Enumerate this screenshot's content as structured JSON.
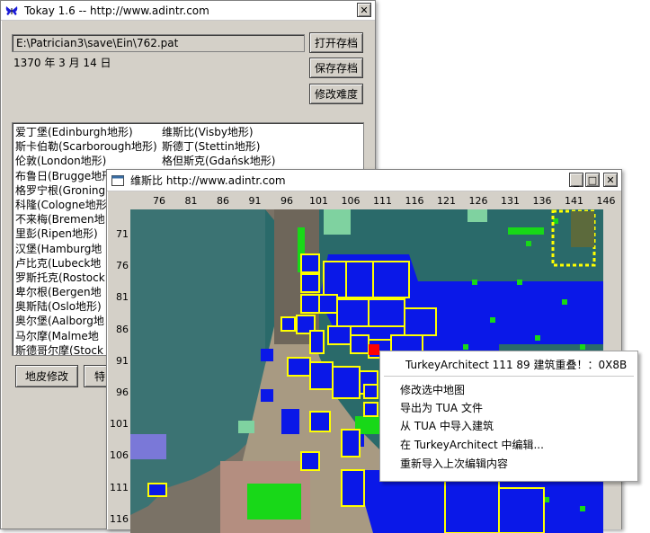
{
  "main_window": {
    "title": "Tokay 1.6 -- http://www.adintr.com",
    "close_glyph": "✕",
    "save_path": "E:\\Patrician3\\save\\Ein\\762.pat",
    "game_date": "1370 年 3 月 14 日",
    "buttons": {
      "open_save": "打开存档",
      "save_save": "保存存档",
      "change_difficulty": "修改难度",
      "terrain_edit": "地皮修改",
      "special_partial": "特"
    },
    "towns_left": [
      "爱丁堡(Edinburgh地形)",
      "斯卡伯勒(Scarborough地形)",
      "伦敦(London地形)",
      "布鲁日(Brugge地形",
      "格罗宁根(Groning",
      "科隆(Cologne地形",
      "不来梅(Bremen地",
      "里彭(Ripen地形)",
      "汉堡(Hamburg地",
      "卢比克(Lubeck地",
      "罗斯托克(Rostock",
      "卑尔根(Bergen地",
      "奥斯陆(Oslo地形)",
      "奥尔堡(Aalborg地",
      "马尔摩(Malme地",
      "斯德哥尔摩(Stock"
    ],
    "towns_right": [
      "维斯比(Visby地形)",
      "斯德丁(Stettin地形)",
      "格但斯克(Gdańsk地形)"
    ]
  },
  "map_window": {
    "title": "维斯比   http://www.adintr.com",
    "buttons": {
      "minimize": "_",
      "maximize": "□",
      "close": "✕"
    },
    "x_ticks": [
      "76",
      "81",
      "86",
      "91",
      "96",
      "101",
      "106",
      "111",
      "116",
      "121",
      "126",
      "131",
      "136",
      "141",
      "146"
    ],
    "y_ticks": [
      "71",
      "76",
      "81",
      "86",
      "91",
      "96",
      "101",
      "106",
      "111",
      "116"
    ]
  },
  "context_menu": {
    "header": "TurkeyArchitect 111 89 建筑重叠！：0X8B",
    "items": [
      "修改选中地图",
      "导出为 TUA 文件",
      "从 TUA 中导入建筑",
      "在 TurkeyArchitect 中编辑...",
      "重新导入上次编辑内容"
    ]
  },
  "colors": {
    "water": "#2a6a6a",
    "sea": "#0a18e8",
    "road": "#787060",
    "grass": "#18d818",
    "building_outline": "#ffff00",
    "selected_tile": "#ff0000"
  },
  "icons": {
    "app": "butterfly-icon",
    "map_window": "window-icon"
  }
}
